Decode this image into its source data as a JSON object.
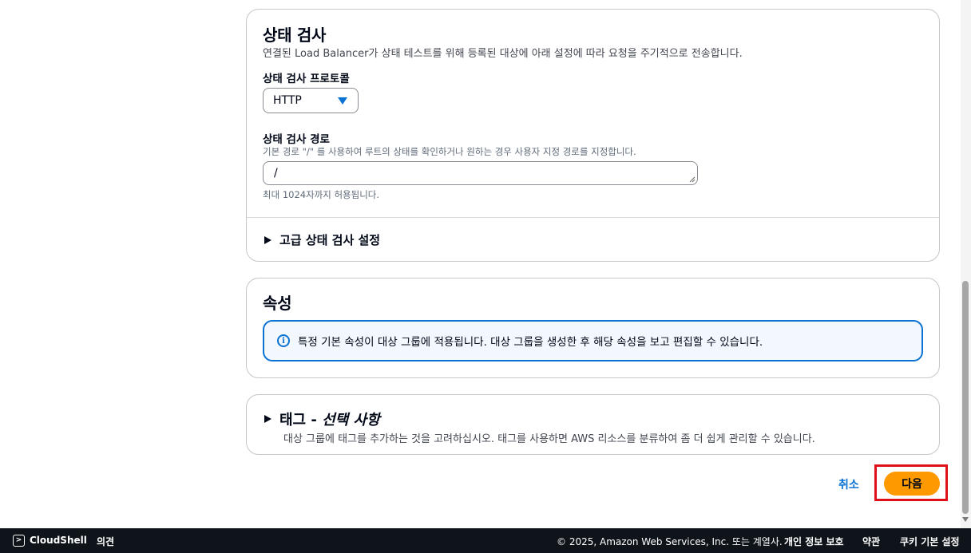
{
  "health_check": {
    "title": "상태 검사",
    "description": "연결된 Load Balancer가 상태 테스트를 위해 등록된 대상에 아래 설정에 따라 요청을 주기적으로 전송합니다.",
    "protocol_label": "상태 검사 프로토콜",
    "protocol_value": "HTTP",
    "path_label": "상태 검사 경로",
    "path_description": "기본 경로 \"/\" 를 사용하여 루트의 상태를 확인하거나 원하는 경우 사용자 지정 경로를 지정합니다.",
    "path_value": "/",
    "path_constraint": "최대 1024자까지 허용됩니다.",
    "advanced_label": "고급 상태 검사 설정"
  },
  "attributes": {
    "title": "속성",
    "info_text": "특정 기본 속성이 대상 그룹에 적용됩니다. 대상 그룹을 생성한 후 해당 속성을 보고 편집할 수 있습니다."
  },
  "tags": {
    "title_main": "태그 - ",
    "title_optional": "선택 사항",
    "description": "대상 그룹에 태그를 추가하는 것을 고려하십시오. 태그를 사용하면 AWS 리소스를 분류하여 좀 더 쉽게 관리할 수 있습니다."
  },
  "actions": {
    "cancel": "취소",
    "next": "다음"
  },
  "footer": {
    "cloudshell": "CloudShell",
    "feedback": "의견",
    "copyright": "© 2025, Amazon Web Services, Inc. 또는 계열사.",
    "privacy": "개인 정보 보호",
    "terms": "약관",
    "cookies": "쿠키 기본 설정"
  },
  "colors": {
    "primary_button": "#ff9900",
    "link": "#0972d3",
    "highlight_outline": "#e0101a",
    "footer_bg": "#0f141a"
  }
}
